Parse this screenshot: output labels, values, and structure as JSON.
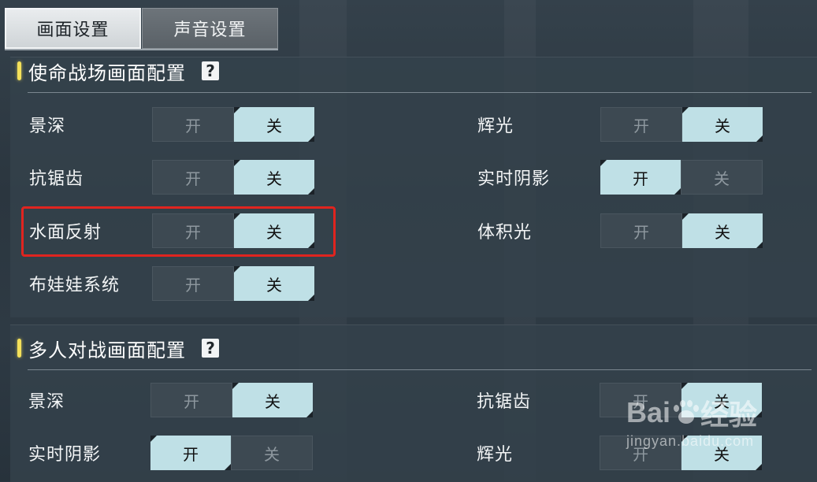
{
  "tabs": [
    {
      "label": "画面设置",
      "active": true
    },
    {
      "label": "声音设置",
      "active": false
    }
  ],
  "sections": [
    {
      "title": "使命战场画面配置",
      "settings": [
        {
          "label": "景深",
          "on": "开",
          "off": "关",
          "selected": "关"
        },
        {
          "label": "抗锯齿",
          "on": "开",
          "off": "关",
          "selected": "关"
        },
        {
          "label": "水面反射",
          "on": "开",
          "off": "关",
          "selected": "关"
        },
        {
          "label": "布娃娃系统",
          "on": "开",
          "off": "关",
          "selected": "关"
        },
        {
          "label": "辉光",
          "on": "开",
          "off": "关",
          "selected": "关"
        },
        {
          "label": "实时阴影",
          "on": "开",
          "off": "关",
          "selected": "开"
        },
        {
          "label": "体积光",
          "on": "开",
          "off": "关",
          "selected": "关"
        }
      ]
    },
    {
      "title": "多人对战画面配置",
      "settings": [
        {
          "label": "景深",
          "on": "开",
          "off": "关",
          "selected": "关"
        },
        {
          "label": "实时阴影",
          "on": "开",
          "off": "关",
          "selected": "开"
        },
        {
          "label": "抗锯齿",
          "on": "开",
          "off": "关",
          "selected": "关"
        },
        {
          "label": "辉光",
          "on": "开",
          "off": "关",
          "selected": "关"
        }
      ]
    }
  ],
  "help_icon_glyph": "?",
  "watermark": {
    "brand": "Bai",
    "brand2": "经验",
    "url": "jingyan.baidu.com"
  },
  "colors": {
    "accent": "#f4e15a",
    "toggle_on": "#bfe0e6",
    "highlight": "#e0241f"
  }
}
